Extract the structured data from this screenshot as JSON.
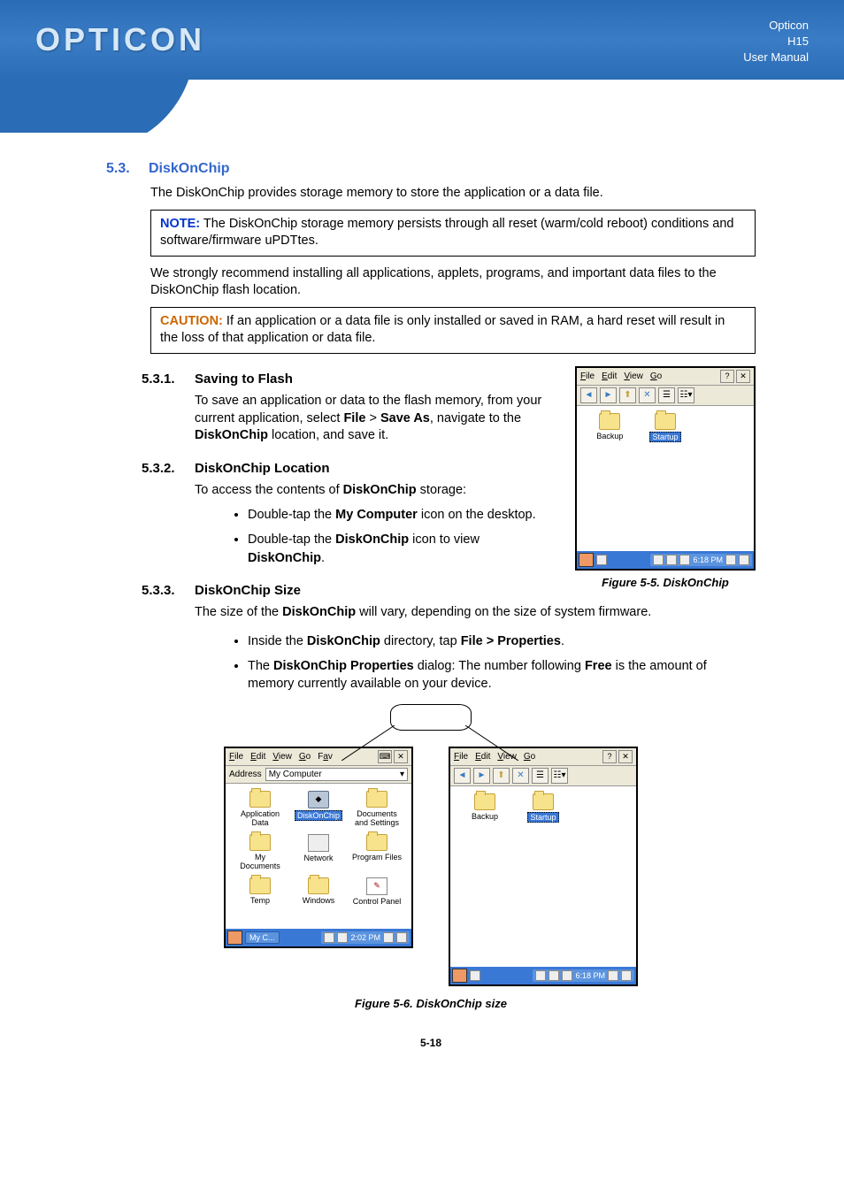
{
  "header": {
    "logo": "OPTICON",
    "right1": "Opticon",
    "right2": "H15",
    "right3": "User Manual"
  },
  "s53": {
    "num": "5.3.",
    "title": "DiskOnChip",
    "p1": "The DiskOnChip provides storage memory to store the application or a data file.",
    "note_label": "NOTE:",
    "note_text": " The DiskOnChip storage memory persists through all reset (warm/cold reboot) conditions and software/firmware uPDTtes.",
    "p2": "We strongly recommend installing all applications, applets, programs, and important data files to the DiskOnChip flash location.",
    "caution_label": "CAUTION:",
    "caution_text": " If an application or a data file is only installed or saved in RAM, a hard reset will result in the loss of that application or data file."
  },
  "s531": {
    "num": "5.3.1.",
    "title": "Saving to Flash",
    "p_pre": "To save an application or data to the flash memory, from your current application, select ",
    "file": "File",
    "gt": " > ",
    "saveas": "Save As",
    "p_mid": ", navigate to the ",
    "doc": "DiskOnChip",
    "p_post": " location, and save it."
  },
  "s532": {
    "num": "5.3.2.",
    "title": "DiskOnChip Location",
    "p_pre": "To access the contents of ",
    "doc": "DiskOnChip",
    "p_post": " storage:",
    "b1_pre": "Double-tap the ",
    "b1_b": "My Computer",
    "b1_post": " icon on the desktop.",
    "b2_pre": "Double-tap the ",
    "b2_b": "DiskOnChip",
    "b2_mid": " icon to view ",
    "b2_b2": "DiskOnChip",
    "b2_post": "."
  },
  "s533": {
    "num": "5.3.3.",
    "title": "DiskOnChip Size",
    "p_pre": "The size of the ",
    "doc": "DiskOnChip",
    "p_post": " will vary, depending on the size of system firmware.",
    "b1_pre": "Inside the ",
    "b1_b": "DiskOnChip",
    "b1_mid": " directory, tap ",
    "b1_b2": "File > Properties",
    "b1_post": ".",
    "b2_pre": "The ",
    "b2_b": "DiskOnChip Properties",
    "b2_mid": " dialog: The number following ",
    "b2_b2": "Free",
    "b2_post": " is the amount of memory currently available on your device."
  },
  "fig55_caption": "Figure 5-5. DiskOnChip",
  "fig56_caption": "Figure 5-6. DiskOnChip size",
  "page_num": "5-18",
  "menu": {
    "file": "File",
    "edit": "Edit",
    "view": "View",
    "go": "Go",
    "fav": "Favi"
  },
  "toolbar": {
    "back": "⬅",
    "fwd": "➡",
    "up": "⬆",
    "del": "✕",
    "prop": "☰",
    "views": "☷",
    "help": "?",
    "close": "✕"
  },
  "shotA": {
    "addr_label": "Address",
    "addr_value": "My Computer",
    "folders": {
      "f1": "Application Data",
      "f2": "DiskOnChip",
      "f3": "Documents and Settings",
      "f4": "My Documents",
      "f5": "Network",
      "f6": "Program Files",
      "f7": "Temp",
      "f8": "Windows",
      "f9": "Control Panel"
    },
    "task": "My C...",
    "time": "2:02 PM"
  },
  "shotB": {
    "folders": {
      "f1": "Backup",
      "f2": "Startup"
    },
    "time": "6:18 PM"
  }
}
